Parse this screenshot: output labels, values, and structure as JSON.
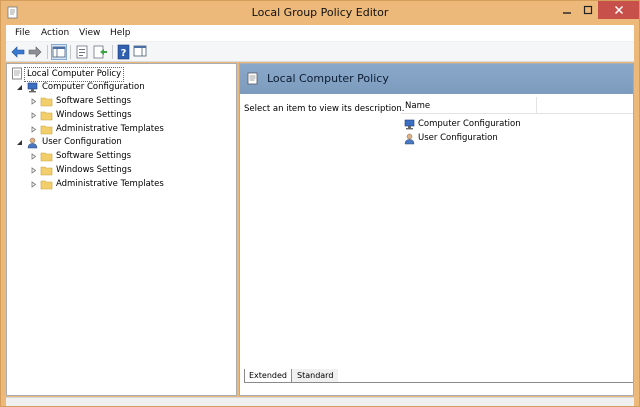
{
  "window": {
    "title": "Local Group Policy Editor",
    "frame_color": "#ecb97a",
    "close_color": "#c7504a"
  },
  "menu": {
    "items": [
      "File",
      "Action",
      "View",
      "Help"
    ]
  },
  "toolbar": {
    "buttons": [
      "back-arrow-icon",
      "forward-arrow-icon",
      "show-hide-tree-icon",
      "properties-icon",
      "export-list-icon",
      "help-icon",
      "show-hide-action-pane-icon"
    ]
  },
  "tree": {
    "root": "Local Computer Policy",
    "computer": {
      "label": "Computer Configuration",
      "children": [
        "Software Settings",
        "Windows Settings",
        "Administrative Templates"
      ]
    },
    "user": {
      "label": "User Configuration",
      "children": [
        "Software Settings",
        "Windows Settings",
        "Administrative Templates"
      ]
    }
  },
  "details": {
    "header_title": "Local Computer Policy",
    "header_color": "#7f9fc2",
    "description": "Select an item to view its description.",
    "column_name": "Name",
    "items": [
      "Computer Configuration",
      "User Configuration"
    ]
  },
  "tabs": {
    "extended": "Extended",
    "standard": "Standard"
  }
}
